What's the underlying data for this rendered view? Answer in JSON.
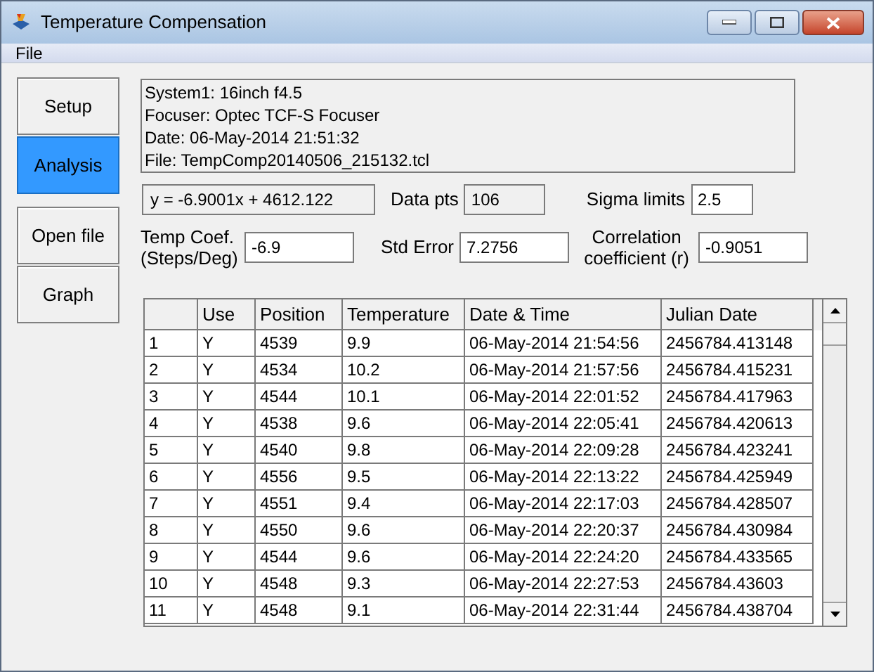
{
  "window": {
    "title": "Temperature Compensation"
  },
  "menu": [
    "File"
  ],
  "side_buttons": [
    {
      "label": "Setup",
      "selected": false
    },
    {
      "label": "Analysis",
      "selected": true
    },
    {
      "label": "Open file",
      "selected": false
    },
    {
      "label": "Graph",
      "selected": false
    }
  ],
  "info_lines": [
    "System1: 16inch f4.5",
    "Focuser: Optec TCF-S Focuser",
    "Date: 06-May-2014 21:51:32",
    "File: TempComp20140506_215132.tcl"
  ],
  "equation": "y = -6.9001x + 4612.122",
  "data_pts": {
    "label": "Data pts",
    "value": "106"
  },
  "sigma_limits": {
    "label": "Sigma limits",
    "value": "2.5"
  },
  "temp_coef": {
    "label": "Temp Coef. (Steps/Deg)",
    "value": "-6.9"
  },
  "std_error": {
    "label": "Std Error",
    "value": "7.2756"
  },
  "correlation": {
    "label": "Correlation coefficient (r)",
    "value": "-0.9051"
  },
  "table": {
    "columns": [
      "",
      "Use",
      "Position",
      "Temperature",
      "Date & Time",
      "Julian Date"
    ],
    "rows": [
      [
        "1",
        "Y",
        "4539",
        "9.9",
        "06-May-2014 21:54:56",
        "2456784.413148"
      ],
      [
        "2",
        "Y",
        "4534",
        "10.2",
        "06-May-2014 21:57:56",
        "2456784.415231"
      ],
      [
        "3",
        "Y",
        "4544",
        "10.1",
        "06-May-2014 22:01:52",
        "2456784.417963"
      ],
      [
        "4",
        "Y",
        "4538",
        "9.6",
        "06-May-2014 22:05:41",
        "2456784.420613"
      ],
      [
        "5",
        "Y",
        "4540",
        "9.8",
        "06-May-2014 22:09:28",
        "2456784.423241"
      ],
      [
        "6",
        "Y",
        "4556",
        "9.5",
        "06-May-2014 22:13:22",
        "2456784.425949"
      ],
      [
        "7",
        "Y",
        "4551",
        "9.4",
        "06-May-2014 22:17:03",
        "2456784.428507"
      ],
      [
        "8",
        "Y",
        "4550",
        "9.6",
        "06-May-2014 22:20:37",
        "2456784.430984"
      ],
      [
        "9",
        "Y",
        "4544",
        "9.6",
        "06-May-2014 22:24:20",
        "2456784.433565"
      ],
      [
        "10",
        "Y",
        "4548",
        "9.3",
        "06-May-2014 22:27:53",
        "2456784.43603"
      ],
      [
        "11",
        "Y",
        "4548",
        "9.1",
        "06-May-2014 22:31:44",
        "2456784.438704"
      ]
    ]
  }
}
